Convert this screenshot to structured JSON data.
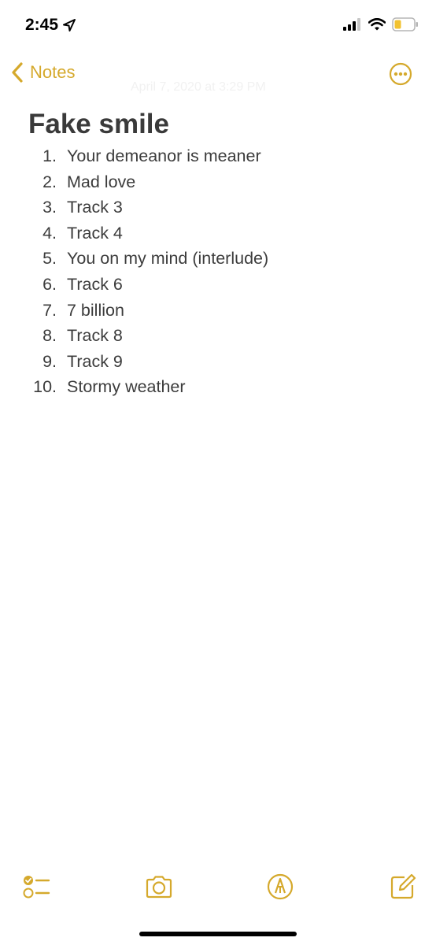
{
  "status_bar": {
    "time": "2:45",
    "icons": [
      "location-arrow-icon",
      "cellular-signal-icon",
      "wifi-icon",
      "battery-icon"
    ]
  },
  "nav": {
    "back_label": "Notes",
    "date": "April 7, 2020 at 3:29 PM",
    "more_icon": "ellipsis-circle-icon"
  },
  "note": {
    "title": "Fake smile",
    "tracks": [
      {
        "number": "1.",
        "text": "Your demeanor is meaner"
      },
      {
        "number": "2.",
        "text": "Mad love"
      },
      {
        "number": "3.",
        "text": "Track 3"
      },
      {
        "number": "4.",
        "text": "Track 4"
      },
      {
        "number": "5.",
        "text": "You on my mind (interlude)"
      },
      {
        "number": "6.",
        "text": "Track 6"
      },
      {
        "number": "7.",
        "text": "7 billion"
      },
      {
        "number": "8.",
        "text": "Track 8"
      },
      {
        "number": "9.",
        "text": "Track 9"
      },
      {
        "number": "10.",
        "text": "Stormy weather"
      }
    ]
  },
  "toolbar": {
    "icons": [
      "checklist-icon",
      "camera-icon",
      "markup-pen-icon",
      "compose-icon"
    ]
  },
  "colors": {
    "accent": "#d5a92c",
    "text": "#3c3c3c",
    "background": "#ffffff"
  }
}
